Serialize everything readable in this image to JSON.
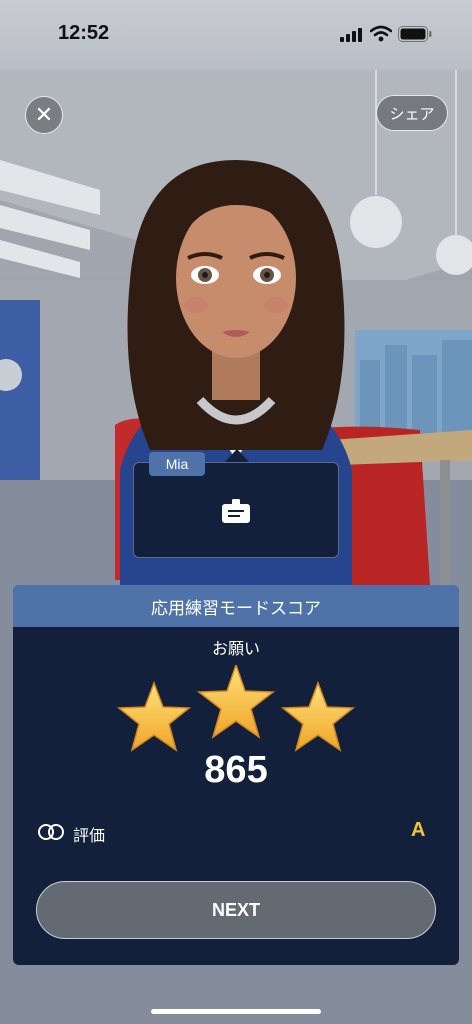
{
  "status_bar": {
    "time": "12:52"
  },
  "top_bar": {
    "close_icon": "close-icon",
    "share_label": "シェア"
  },
  "speaker": {
    "name": "Mia",
    "bubble_icon": "note-icon"
  },
  "score_panel": {
    "title": "応用練習モードスコア",
    "phrase": "お願い",
    "stars_earned": 3,
    "stars_total": 3,
    "score": "865",
    "rating_label": "評価",
    "rating_value": "A",
    "next_label": "NEXT"
  },
  "colors": {
    "panel": "#13203b",
    "header": "#4f73a8",
    "star": "#f6c443",
    "grade": "#f3c331"
  }
}
